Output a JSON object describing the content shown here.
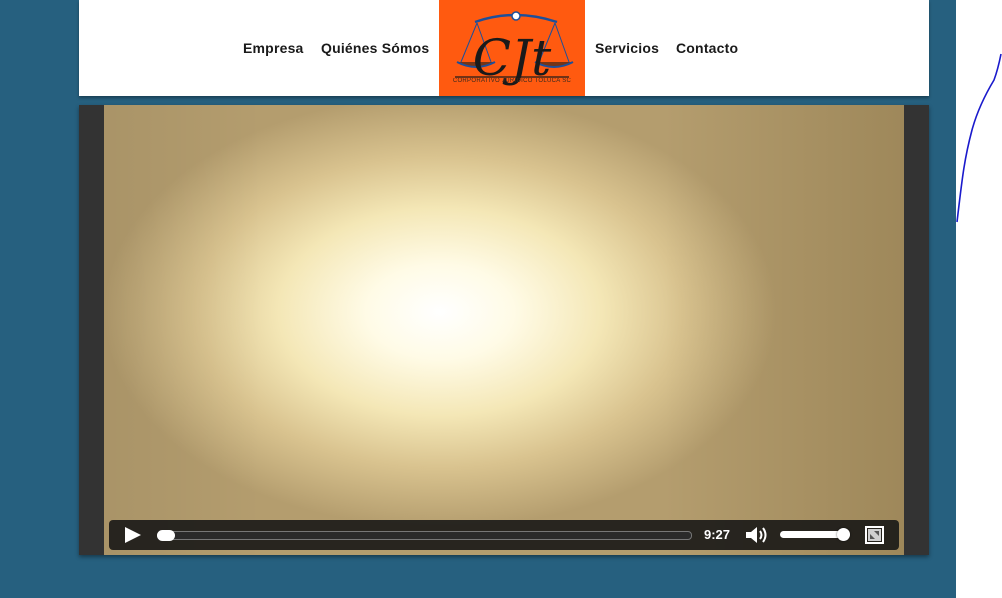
{
  "nav": {
    "items": [
      "Empresa",
      "Quiénes Sómos",
      "Servicios",
      "Contacto"
    ]
  },
  "logo": {
    "text": "CJt",
    "subtitle": "CORPORATIVO JURÍDICO TOLUCA SC",
    "background_color": "#ff5a10"
  },
  "player": {
    "time": "9:27",
    "progress_fraction": 0.0,
    "volume_fraction": 0.9,
    "icons": [
      "play-icon",
      "volume-icon",
      "fullscreen-icon"
    ]
  },
  "colors": {
    "page_background": "#26607f",
    "header_background": "#ffffff",
    "player_frame": "#333333",
    "annotation_stroke": "#1a1acc"
  }
}
